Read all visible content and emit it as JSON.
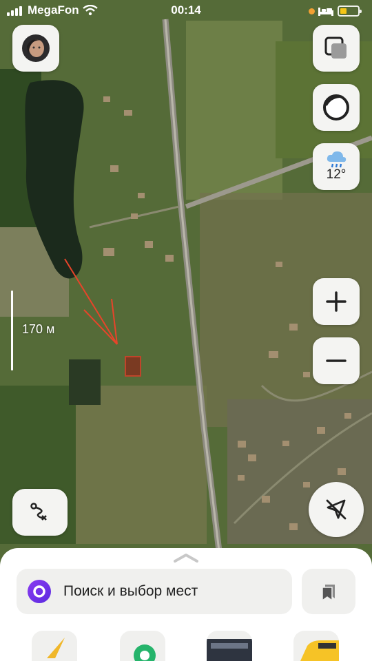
{
  "status_bar": {
    "carrier": "MegaFon",
    "time": "00:14",
    "battery_color": "#f4c617"
  },
  "map": {
    "scale_label": "170 м",
    "annotation_color": "#e8442a"
  },
  "controls": {
    "avatar": "avatar",
    "layers": "layers-icon",
    "alice": "alice-icon",
    "weather_icon": "cloud-rain-icon",
    "temperature": "12°",
    "zoom_in": "+",
    "zoom_out": "−",
    "route": "route-icon",
    "locate": "location-off-icon"
  },
  "bottom_sheet": {
    "search_placeholder": "Поиск и выбор мест",
    "bookmarks": "bookmarks-icon",
    "shortcuts": [
      "navigator-icon",
      "metro-icon",
      "transport-icon",
      "taxi-icon"
    ]
  }
}
